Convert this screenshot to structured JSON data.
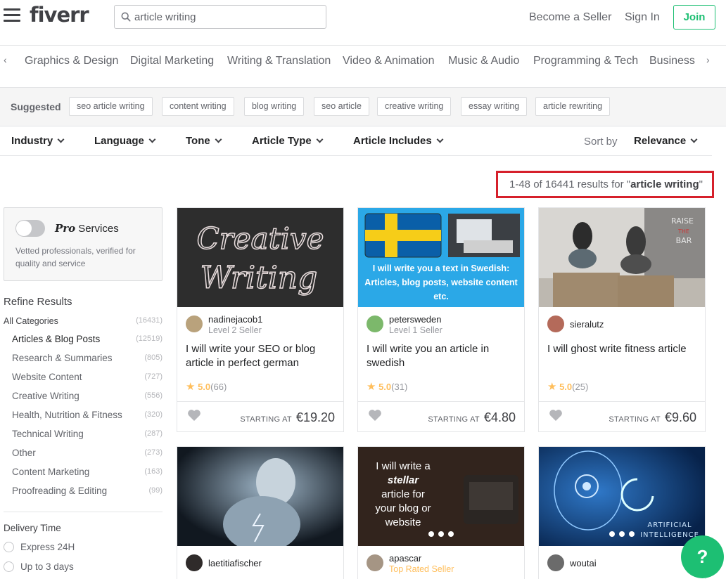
{
  "header": {
    "logo": "fiverr",
    "search": {
      "value": "article writing",
      "placeholder": ""
    },
    "become_seller": "Become a Seller",
    "sign_in": "Sign In",
    "join": "Join"
  },
  "categories": [
    "Graphics & Design",
    "Digital Marketing",
    "Writing & Translation",
    "Video & Animation",
    "Music & Audio",
    "Programming & Tech",
    "Business"
  ],
  "suggested": {
    "label": "Suggested",
    "tags": [
      "seo article writing",
      "content writing",
      "blog writing",
      "seo article",
      "creative writing",
      "essay writing",
      "article rewriting"
    ]
  },
  "filters": {
    "items": [
      "Industry",
      "Language",
      "Tone",
      "Article Type",
      "Article Includes"
    ],
    "sort_label": "Sort by",
    "sort_value": "Relevance"
  },
  "results": {
    "prefix": "1-48 of 16441 results for \"",
    "query": "article writing",
    "suffix": "\""
  },
  "pro": {
    "pro_word": "Pro",
    "services": "Services",
    "description": "Vetted professionals, verified for quality and service"
  },
  "refine": {
    "title": "Refine Results",
    "all_label": "All Categories",
    "all_count": "(16431)",
    "items": [
      {
        "label": "Articles & Blog Posts",
        "count": "(12519)"
      },
      {
        "label": "Research & Summaries",
        "count": "(805)"
      },
      {
        "label": "Website Content",
        "count": "(727)"
      },
      {
        "label": "Creative Writing",
        "count": "(556)"
      },
      {
        "label": "Health, Nutrition & Fitness",
        "count": "(320)"
      },
      {
        "label": "Technical Writing",
        "count": "(287)"
      },
      {
        "label": "Other",
        "count": "(273)"
      },
      {
        "label": "Content Marketing",
        "count": "(163)"
      },
      {
        "label": "Proofreading & Editing",
        "count": "(99)"
      }
    ]
  },
  "delivery": {
    "title": "Delivery Time",
    "options": [
      "Express 24H",
      "Up to 3 days"
    ]
  },
  "gigs": [
    {
      "image_text": [
        "Creative",
        "Writing"
      ],
      "seller": "nadinejacob1",
      "level": "Level 2 Seller",
      "title": "I will write your SEO or blog article in perfect german",
      "score": "5.0",
      "reviews": "(66)",
      "starting_at": "STARTING AT",
      "price": "€19.20"
    },
    {
      "image_text": "I will write you a text in Swedish: Articles, blog posts, website content etc.",
      "seller": "petersweden",
      "level": "Level 1 Seller",
      "title": "I will write you an article in swedish",
      "score": "5.0",
      "reviews": "(31)",
      "starting_at": "STARTING AT",
      "price": "€4.80"
    },
    {
      "image_text": [
        "RAISE",
        "THE",
        "BAR"
      ],
      "seller": "sieralutz",
      "level": "",
      "title": "I will ghost write fitness article",
      "score": "5.0",
      "reviews": "(25)",
      "starting_at": "STARTING AT",
      "price": "€9.60"
    },
    {
      "seller": "laetitiafischer",
      "level": ""
    },
    {
      "image_text": [
        "I will write a",
        "stellar",
        "article for",
        "your blog or",
        "website"
      ],
      "seller": "apascar",
      "level": "Top Rated Seller"
    },
    {
      "image_text": [
        "ARTIFICIAL",
        "INTELLIGENCE"
      ],
      "seller": "woutai",
      "level": ""
    }
  ],
  "help": "?",
  "colors": {
    "brand": "#1dbf73",
    "star": "#ffbe5b",
    "highlight": "#d6202b",
    "top_rated": "#ffbe5b"
  }
}
